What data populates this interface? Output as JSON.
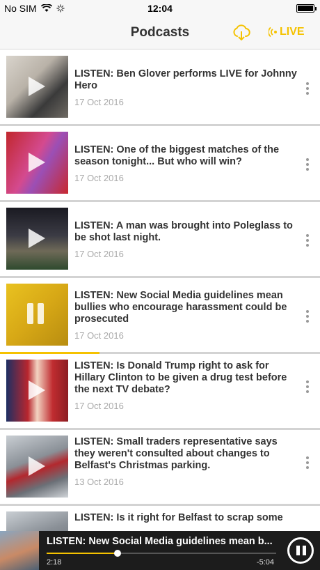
{
  "status": {
    "carrier": "No SIM",
    "time": "12:04"
  },
  "nav": {
    "title": "Podcasts",
    "live_label": "LIVE",
    "download_icon": "download-icon",
    "live_icon": "broadcast-icon"
  },
  "accent": "#f5c200",
  "episodes": [
    {
      "title": "LISTEN: Ben Glover performs LIVE for Johnny Hero",
      "date": "17 Oct 2016",
      "state": "play"
    },
    {
      "title": "LISTEN: One of the biggest matches of the season tonight... But who will win?",
      "date": "17 Oct 2016",
      "state": "play"
    },
    {
      "title": "LISTEN: A man was brought into Poleglass to be shot last night.",
      "date": "17 Oct 2016",
      "state": "play"
    },
    {
      "title": "LISTEN: New Social Media guidelines mean bullies who encourage harassment could be prosecuted",
      "date": "17 Oct 2016",
      "state": "pause",
      "progress": 0.31
    },
    {
      "title": "LISTEN: Is Donald Trump right to ask for Hillary Clinton to be given a drug test before the next TV debate?",
      "date": "17 Oct 2016",
      "state": "play"
    },
    {
      "title": "LISTEN: Small traders representative says they weren't consulted about changes to Belfast's Christmas parking.",
      "date": "13 Oct 2016",
      "state": "play"
    },
    {
      "title": "LISTEN: Is it right for Belfast to scrap some",
      "date": "",
      "state": "play"
    }
  ],
  "player": {
    "title": "LISTEN: New Social Media guidelines mean b...",
    "elapsed": "2:18",
    "remaining": "-5:04",
    "progress": 0.31
  }
}
